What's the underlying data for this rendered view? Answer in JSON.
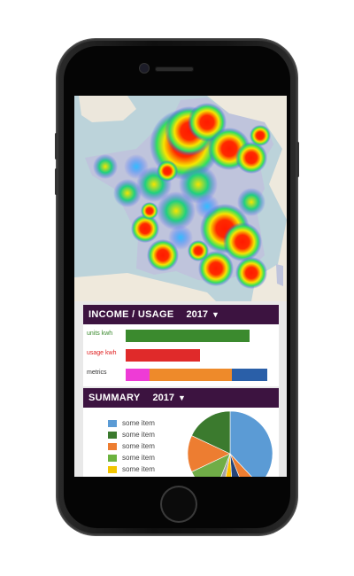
{
  "income_panel": {
    "title": "INCOME / USAGE",
    "year": "2017",
    "arrow": "▼",
    "bars": [
      {
        "label": "units kwh",
        "label_color": "#3b8a2e",
        "bar_color": "#3b8a2e",
        "value": 1.0
      },
      {
        "label": "usage kwh",
        "label_color": "#e02020",
        "bar_color": "#e02a2a",
        "value": 0.6
      },
      {
        "label": "metrics",
        "label_color": "#333333",
        "segments": [
          {
            "color": "#ee3bd6",
            "value": 0.17
          },
          {
            "color": "#ee8a2a",
            "value": 0.56
          },
          {
            "color": "#2a5fa8",
            "value": 0.27
          }
        ]
      }
    ]
  },
  "summary_panel": {
    "title": "SUMMARY",
    "year": "2017",
    "arrow": "▼",
    "legend": [
      {
        "label": "some item",
        "color": "#5b9bd5"
      },
      {
        "label": "some item",
        "color": "#3b7a2e"
      },
      {
        "label": "some item",
        "color": "#ed7d31"
      },
      {
        "label": "some item",
        "color": "#6cb33f"
      },
      {
        "label": "some item",
        "color": "#f2c500"
      }
    ],
    "pie": [
      {
        "color": "#5b9bd5",
        "value": 0.38
      },
      {
        "color": "#ed7d31",
        "value": 0.06
      },
      {
        "color": "#264478",
        "value": 0.05
      },
      {
        "color": "#ffc000",
        "value": 0.04
      },
      {
        "color": "#a5a5a5",
        "value": 0.03
      },
      {
        "color": "#70ad47",
        "value": 0.12
      },
      {
        "color": "#ed7d31",
        "value": 0.14
      },
      {
        "color": "#3b7a2e",
        "value": 0.18
      }
    ]
  }
}
